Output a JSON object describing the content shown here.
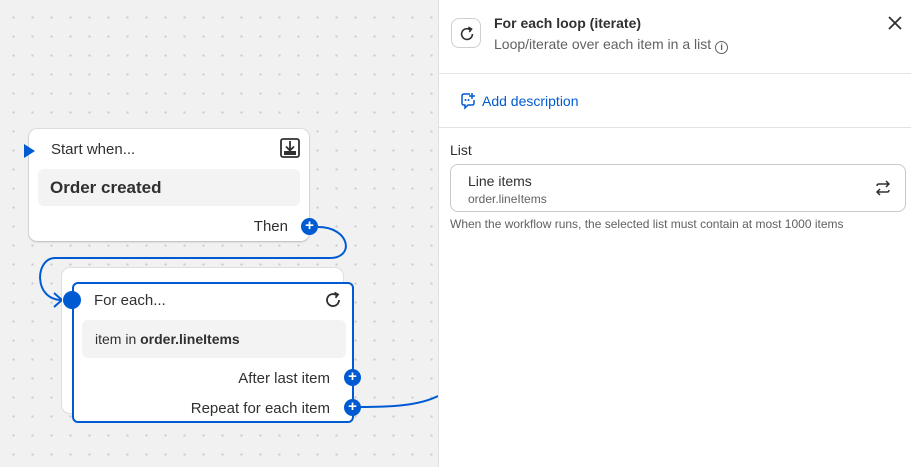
{
  "canvas": {
    "start_node": {
      "title": "Start when...",
      "event": "Order created",
      "connector_label": "Then"
    },
    "loop_node": {
      "title": "For each...",
      "item_prefix": "item in",
      "item_list": "order.lineItems",
      "after_label": "After last item",
      "repeat_label": "Repeat for each item"
    }
  },
  "panel": {
    "title": "For each loop (iterate)",
    "description": "Loop/iterate over each item in a list",
    "add_description": "Add description",
    "list_label": "List",
    "list_value": "Line items",
    "list_path": "order.lineItems",
    "help_text": "When the workflow runs, the selected list must contain at most 1000 items"
  },
  "icons": {
    "loop": "refresh-icon",
    "close": "close-icon",
    "info": "info-icon",
    "add_description": "chat-add-icon",
    "swap": "swap-icon",
    "trigger": "download-icon"
  },
  "colors": {
    "accent": "#005bd3",
    "canvas_bg": "#f1f1f1",
    "panel_bg": "#ffffff"
  }
}
